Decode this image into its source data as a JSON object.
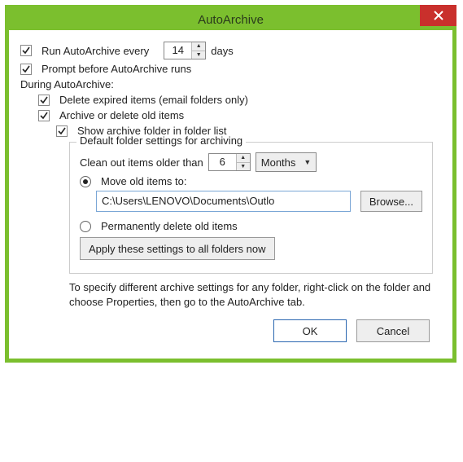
{
  "title": "AutoArchive",
  "runEvery": {
    "label_before": "Run AutoArchive every",
    "value": "14",
    "label_after": "days",
    "checked": true
  },
  "promptBefore": {
    "label": "Prompt before AutoArchive runs",
    "checked": true
  },
  "duringLabel": "During AutoArchive:",
  "deleteExpired": {
    "label": "Delete expired items (email folders only)",
    "checked": true
  },
  "archiveOld": {
    "label": "Archive or delete old items",
    "checked": true
  },
  "showFolder": {
    "label": "Show archive folder in folder list",
    "checked": true
  },
  "group": {
    "title": "Default folder settings for archiving",
    "cleanOut": {
      "label": "Clean out items older than",
      "value": "6",
      "unit": "Months"
    },
    "moveOld": {
      "label": "Move old items to:",
      "selected": true
    },
    "path": "C:\\Users\\LENOVO\\Documents\\Outlo",
    "browse": "Browse...",
    "permDelete": {
      "label": "Permanently delete old items",
      "selected": false
    },
    "applyAll": "Apply these settings to all folders now"
  },
  "helpText": "To specify different archive settings for any folder, right-click on the folder and choose Properties, then go to the AutoArchive tab.",
  "buttons": {
    "ok": "OK",
    "cancel": "Cancel"
  }
}
